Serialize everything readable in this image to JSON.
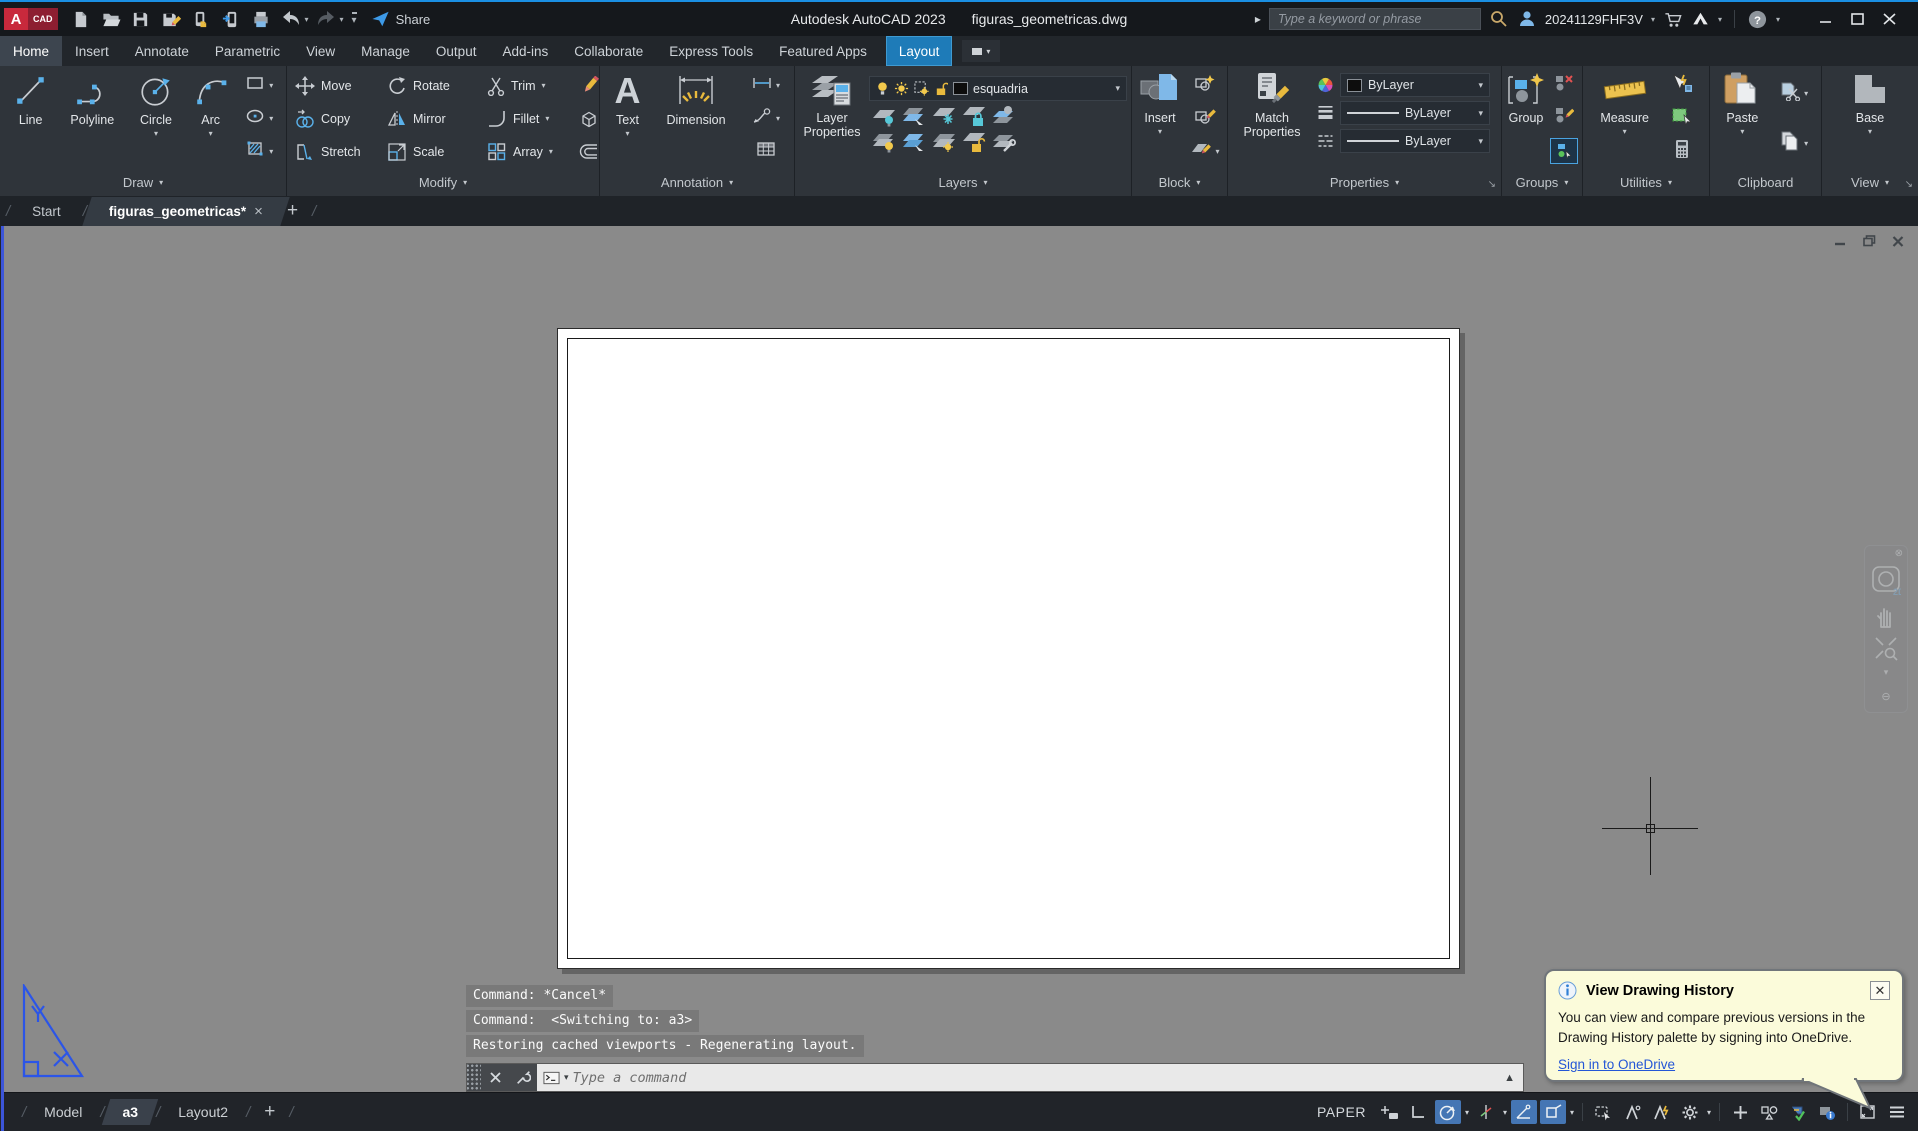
{
  "titlebar": {
    "app_title": "Autodesk AutoCAD 2023",
    "doc_title": "figuras_geometricas.dwg",
    "share_label": "Share",
    "search_placeholder": "Type a keyword or phrase",
    "user_id": "20241129FHF3V",
    "qat_icons": [
      "autocad-logo",
      "new-file",
      "open-file",
      "save",
      "save-as",
      "open-from-mobile",
      "save-to-mobile",
      "plot",
      "undo",
      "redo",
      "customize-quick-access",
      "share"
    ]
  },
  "ribbon": {
    "tabs": [
      "Home",
      "Insert",
      "Annotate",
      "Parametric",
      "View",
      "Manage",
      "Output",
      "Add-ins",
      "Collaborate",
      "Express Tools",
      "Featured Apps",
      "Layout"
    ],
    "active_tab": "Home",
    "contextual_tab": "Layout",
    "panels": {
      "draw": {
        "label": "Draw",
        "line": "Line",
        "polyline": "Polyline",
        "circle": "Circle",
        "arc": "Arc",
        "small_icons": [
          "rectangle",
          "ellipse",
          "hatch"
        ]
      },
      "modify": {
        "label": "Modify",
        "move": "Move",
        "rotate": "Rotate",
        "trim": "Trim",
        "copy": "Copy",
        "mirror": "Mirror",
        "fillet": "Fillet",
        "stretch": "Stretch",
        "scale": "Scale",
        "array": "Array",
        "small_icons": [
          "erase",
          "explode",
          "offset"
        ]
      },
      "annotation": {
        "label": "Annotation",
        "text": "Text",
        "dimension": "Dimension",
        "small_icons": [
          "linear-dimension",
          "leader",
          "table"
        ]
      },
      "layers": {
        "label": "Layers",
        "layer_properties": "Layer Properties",
        "current_layer": "esquadria",
        "dropdown_icons": [
          "layer-on-bulb",
          "layer-sun",
          "layer-viewport-sun",
          "layer-unlock",
          "layer-color-swatch"
        ],
        "tool_icons": [
          "layer-off",
          "layer-isolate",
          "layer-freeze",
          "layer-lock",
          "layer-make-current",
          "layer-turn-all-on",
          "layer-unisolate",
          "layer-thaw",
          "layer-unlock-all",
          "layer-match"
        ]
      },
      "block": {
        "label": "Block",
        "insert": "Insert",
        "small_icons": [
          "create-block",
          "edit-block",
          "edit-attributes"
        ]
      },
      "properties": {
        "label": "Properties",
        "match_properties": "Match Properties",
        "color": "ByLayer",
        "lineweight": "ByLayer",
        "linetype": "ByLayer"
      },
      "groups": {
        "label": "Groups",
        "group": "Group",
        "small_icons": [
          "ungroup",
          "group-edit",
          "group-selection-toggle"
        ]
      },
      "utilities": {
        "label": "Utilities",
        "measure": "Measure",
        "small_icons": [
          "quick-select",
          "select-similar",
          "quick-calculator"
        ]
      },
      "clipboard": {
        "label": "Clipboard",
        "paste": "Paste",
        "small_icons": [
          "cut",
          "copy-clip"
        ]
      },
      "view": {
        "label": "View",
        "base": "Base"
      }
    }
  },
  "file_tabs": {
    "start": "Start",
    "drawing": "figuras_geometricas*"
  },
  "command": {
    "history": [
      "Command: *Cancel*",
      "Command:  <Switching to: a3>",
      "Restoring cached viewports - Regenerating layout."
    ],
    "placeholder": "Type a command"
  },
  "statusbar": {
    "model_tab": "Model",
    "layout_tab_a3": "a3",
    "layout_tab_2": "Layout2",
    "space_label": "PAPER",
    "icons": [
      "snap-mode",
      "ortho-mode",
      "polar-tracking",
      "isometric-drafting",
      "object-snap-tracking",
      "object-snap",
      "selection-cycling",
      "annotation-visibility",
      "annotation-autoscale",
      "annotation-scale-gear",
      "add-scales",
      "quick-properties",
      "graphics-performance",
      "hardware-acceleration",
      "clean-screen",
      "customization-menu"
    ],
    "active_toggles": [
      "polar-tracking",
      "object-snap-tracking",
      "object-snap"
    ]
  },
  "notification": {
    "title": "View Drawing History",
    "body": "You can view and compare previous versions in the Drawing History palette by signing into OneDrive.",
    "link": "Sign in to OneDrive"
  },
  "colors": {
    "contextual_tab_blue": "#1e7bb8",
    "status_toggle_active": "#4576b4",
    "notification_bg": "#fbfbda",
    "canvas_gray": "#8a8a8a",
    "paper_white": "#ffffff",
    "ucs_blue": "#2b55e8",
    "accent_blue": "#5ab1ea",
    "accent_yellow": "#e9ba3d"
  }
}
